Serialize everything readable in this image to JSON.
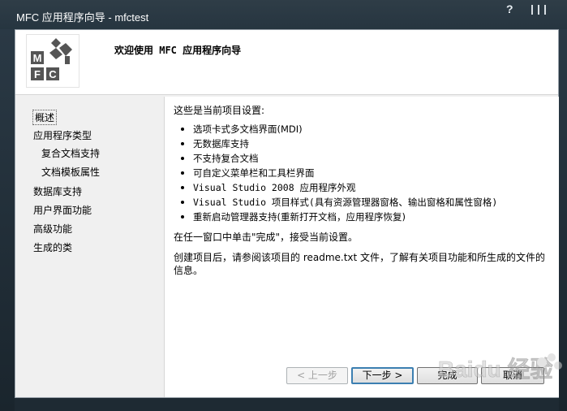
{
  "window": {
    "title": "MFC 应用程序向导 - mfctest",
    "help_glyph": "?"
  },
  "header": {
    "title": "欢迎使用 MFC 应用程序向导",
    "logo_letters": [
      "M",
      "F",
      "C"
    ]
  },
  "nav": {
    "items": [
      {
        "label": "概述",
        "active": true
      },
      {
        "label": "应用程序类型"
      },
      {
        "label": "复合文档支持"
      },
      {
        "label": "文档模板属性"
      },
      {
        "label": "数据库支持"
      },
      {
        "label": "用户界面功能"
      },
      {
        "label": "高级功能"
      },
      {
        "label": "生成的类"
      }
    ]
  },
  "content": {
    "intro": "这些是当前项目设置:",
    "bullets": [
      "选项卡式多文档界面(MDI)",
      "无数据库支持",
      "不支持复合文档",
      "可自定义菜单栏和工具栏界面",
      "Visual Studio 2008 应用程序外观",
      "Visual Studio 项目样式(具有资源管理器窗格、输出窗格和属性窗格)",
      "重新启动管理器支持(重新打开文档，应用程序恢复)"
    ],
    "para1": "在任一窗口中单击\"完成\"，接受当前设置。",
    "para2": "创建项目后，请参阅该项目的 readme.txt 文件，了解有关项目功能和所生成的文件的信息。"
  },
  "buttons": {
    "back": "< 上一步",
    "next": "下一步 >",
    "finish": "完成",
    "cancel": "取消"
  },
  "watermark": {
    "text": "Baidu 经验"
  },
  "colors": {
    "title_bar": "#263540",
    "dialog_bg": "#f0f0f0",
    "default_button_border": "#3c7fb1",
    "logo_gray": "#555555"
  }
}
